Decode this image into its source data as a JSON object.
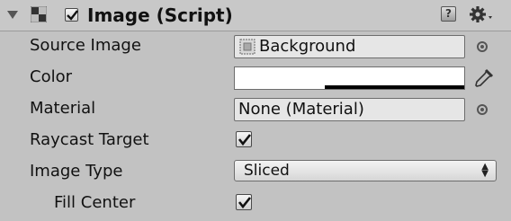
{
  "component": {
    "title": "Image (Script)",
    "enabled": true,
    "icons": {
      "foldout": "foldout-triangle-expanded",
      "component": "image-component-icon",
      "help": "help-book-icon",
      "settings": "gear-icon"
    }
  },
  "properties": {
    "source_image": {
      "label": "Source Image",
      "value": "Background",
      "value_icon": "sprite-icon",
      "picker_icon": "object-picker-icon"
    },
    "color": {
      "label": "Color",
      "value": "#ffffff",
      "alpha": 1.0,
      "eyedropper_icon": "eyedropper-icon"
    },
    "material": {
      "label": "Material",
      "value": "None (Material)",
      "picker_icon": "object-picker-icon"
    },
    "raycast_target": {
      "label": "Raycast Target",
      "checked": true
    },
    "image_type": {
      "label": "Image Type",
      "value": "Sliced",
      "options_icon": "dropdown-arrows-icon"
    },
    "fill_center": {
      "label": "Fill Center",
      "checked": true
    }
  }
}
